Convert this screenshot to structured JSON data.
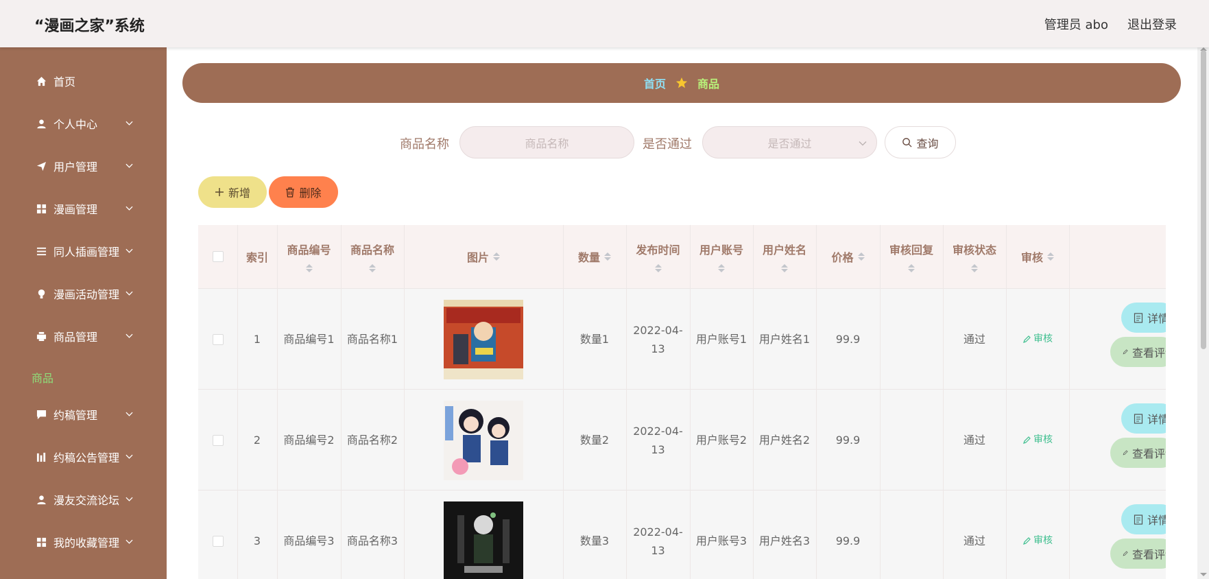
{
  "header": {
    "brand": "“漫画之家”系统",
    "admin_label": "管理员 abo",
    "logout_label": "退出登录"
  },
  "sidebar": {
    "items": [
      {
        "label": "首页",
        "icon": "home-icon"
      },
      {
        "label": "个人中心",
        "icon": "user-icon"
      },
      {
        "label": "用户管理",
        "icon": "send-icon"
      },
      {
        "label": "漫画管理",
        "icon": "grid-icon"
      },
      {
        "label": "同人插画管理",
        "icon": "list-icon"
      },
      {
        "label": "漫画活动管理",
        "icon": "bulb-icon"
      },
      {
        "label": "商品管理",
        "icon": "printer-icon"
      },
      {
        "label": "约稿管理",
        "icon": "chat-icon"
      },
      {
        "label": "约稿公告管理",
        "icon": "bars-icon"
      },
      {
        "label": "漫友交流论坛",
        "icon": "user-icon"
      },
      {
        "label": "我的收藏管理",
        "icon": "grid-icon"
      }
    ],
    "submenu_active": "商品"
  },
  "breadcrumb": {
    "home": "首页",
    "current": "商品"
  },
  "search": {
    "name_label": "商品名称",
    "name_placeholder": "商品名称",
    "pass_label": "是否通过",
    "pass_placeholder": "是否通过",
    "query_label": "查询"
  },
  "toolbar": {
    "add_label": "新增",
    "delete_label": "删除"
  },
  "table": {
    "columns": [
      "索引",
      "商品编号",
      "商品名称",
      "图片",
      "数量",
      "发布时间",
      "用户账号",
      "用户姓名",
      "价格",
      "审核回复",
      "审核状态",
      "审核"
    ],
    "rows": [
      {
        "index": "1",
        "code": "商品编号1",
        "name": "商品名称1",
        "qty": "数量1",
        "time": "2022-04-13",
        "account": "用户账号1",
        "username": "用户姓名1",
        "price": "99.9",
        "reply": "",
        "status": "通过",
        "approve": "审核",
        "detail": "详情",
        "review": "查看评论"
      },
      {
        "index": "2",
        "code": "商品编号2",
        "name": "商品名称2",
        "qty": "数量2",
        "time": "2022-04-13",
        "account": "用户账号2",
        "username": "用户姓名2",
        "price": "99.9",
        "reply": "",
        "status": "通过",
        "approve": "审核",
        "detail": "详情",
        "review": "查看评论"
      },
      {
        "index": "3",
        "code": "商品编号3",
        "name": "商品名称3",
        "qty": "数量3",
        "time": "2022-04-13",
        "account": "用户账号3",
        "username": "用户姓名3",
        "price": "99.9",
        "reply": "",
        "status": "通过",
        "approve": "审核",
        "detail": "详情",
        "review": "查看评论"
      }
    ]
  },
  "colors": {
    "sidebar_bg": "#9e6d55",
    "add_button": "#efe18a",
    "delete_button": "#ff814d",
    "detail_button": "#a9eaf0",
    "review_button": "#c8e5c4",
    "approve_link": "#3fbf8f",
    "submenu_active": "#8ee07a"
  }
}
